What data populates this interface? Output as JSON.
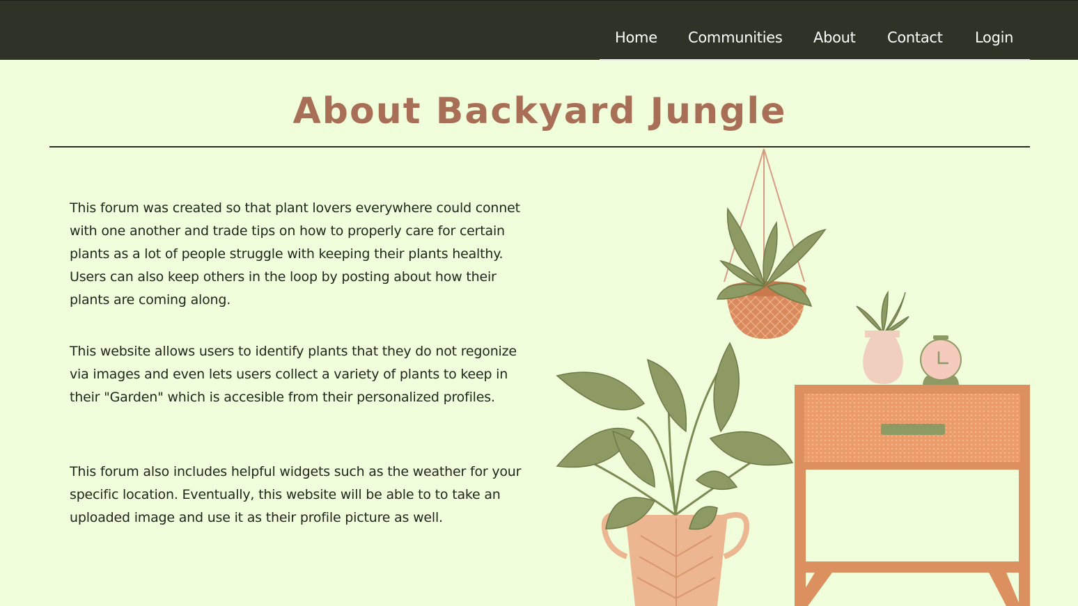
{
  "nav": {
    "items": [
      {
        "label": "Home"
      },
      {
        "label": "Communities"
      },
      {
        "label": "About"
      },
      {
        "label": "Contact"
      },
      {
        "label": "Login"
      }
    ]
  },
  "main": {
    "title": "About Backyard Jungle",
    "paragraphs": [
      "This forum was created so that plant lovers everywhere could connet with one another and trade tips on how to properly care for certain plants as a lot of people struggle with keeping their plants healthy. Users can also keep others in the loop by posting about how their plants are coming along.",
      "This website allows users to identify plants that they do not regonize via images and even lets users collect a variety of plants to keep in their \"Garden\" which is accesible from their personalized profiles.",
      "This forum also includes helpful widgets such as the weather for your specific location. Eventually, this website will be able to to take an uploaded image and use it as their profile picture as well."
    ]
  },
  "colors": {
    "navbar_bg": "#2f3327",
    "page_bg": "#f1fedb",
    "title": "#a86f56",
    "leaf": "#8e9a64",
    "terracotta": "#d88d5e",
    "pot_peach": "#ecb690"
  }
}
